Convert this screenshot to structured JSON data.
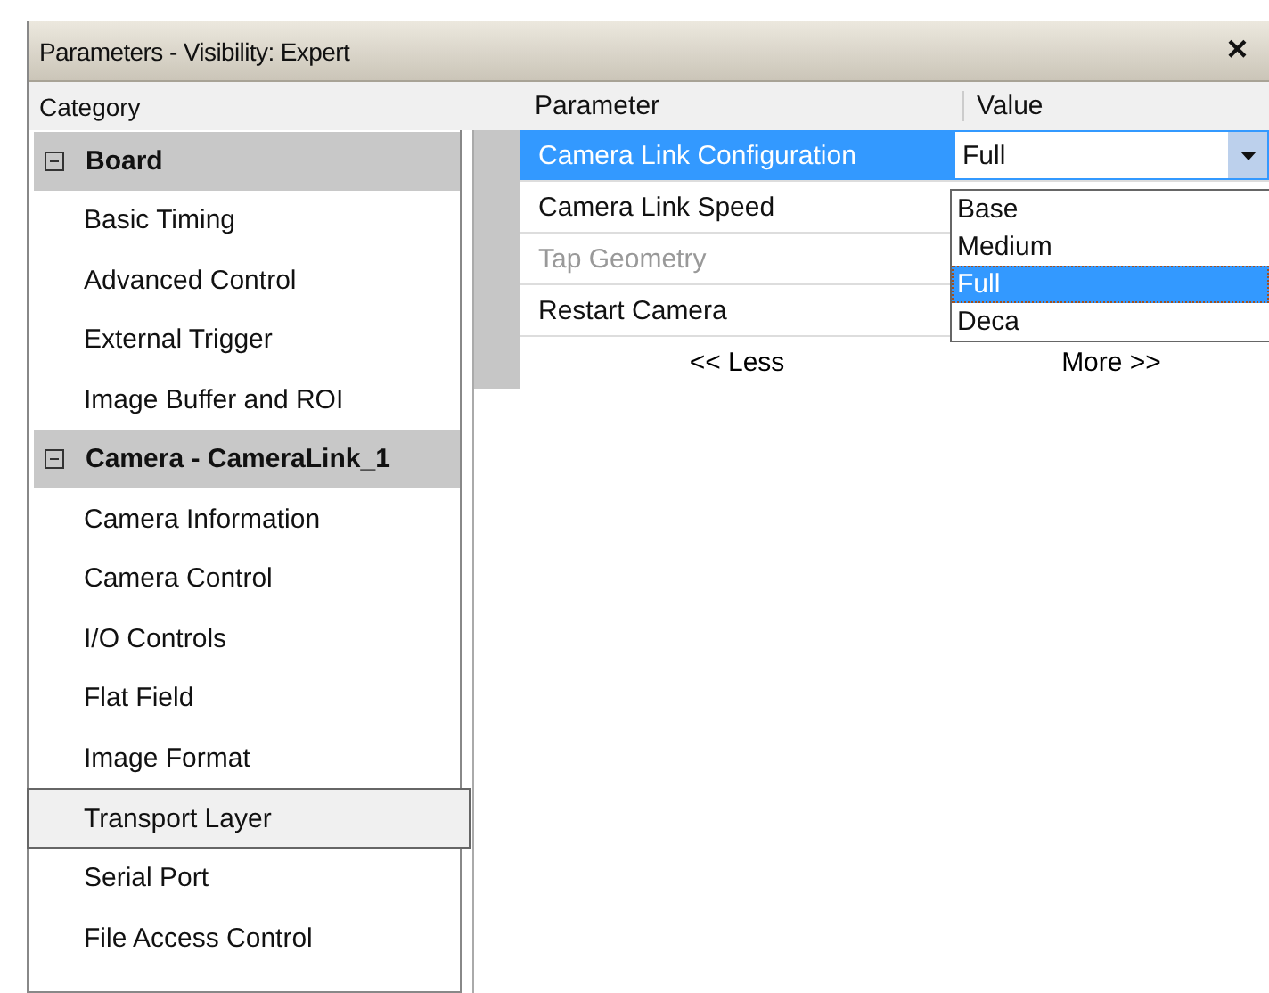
{
  "window": {
    "title": "Parameters - Visibility: Expert",
    "close": "×"
  },
  "columns": {
    "category": "Category",
    "parameter": "Parameter",
    "value": "Value"
  },
  "categories": [
    {
      "label": "Board",
      "expanded": true,
      "children": [
        {
          "label": "Basic Timing",
          "selected": false
        },
        {
          "label": "Advanced Control",
          "selected": false
        },
        {
          "label": "External Trigger",
          "selected": false
        },
        {
          "label": "Image Buffer and ROI",
          "selected": false
        }
      ]
    },
    {
      "label": "Camera - CameraLink_1",
      "expanded": true,
      "children": [
        {
          "label": "Camera Information",
          "selected": false
        },
        {
          "label": "Camera Control",
          "selected": false
        },
        {
          "label": "I/O Controls",
          "selected": false
        },
        {
          "label": "Flat Field",
          "selected": false
        },
        {
          "label": "Image Format",
          "selected": false
        },
        {
          "label": "Transport Layer",
          "selected": true
        },
        {
          "label": "Serial Port",
          "selected": false
        },
        {
          "label": "File Access Control",
          "selected": false
        }
      ]
    }
  ],
  "parameters": [
    {
      "name": "Camera Link Configuration",
      "selected": true,
      "disabled": false,
      "value": "Full"
    },
    {
      "name": "Camera Link Speed",
      "selected": false,
      "disabled": false
    },
    {
      "name": "Tap Geometry",
      "selected": false,
      "disabled": true
    },
    {
      "name": "Restart Camera",
      "selected": false,
      "disabled": false
    }
  ],
  "dropdown": {
    "options": [
      {
        "label": "Base",
        "selected": false
      },
      {
        "label": "Medium",
        "selected": false
      },
      {
        "label": "Full",
        "selected": true
      },
      {
        "label": "Deca",
        "selected": false
      }
    ]
  },
  "buttons": {
    "less": "<< Less",
    "more": "More >>"
  }
}
